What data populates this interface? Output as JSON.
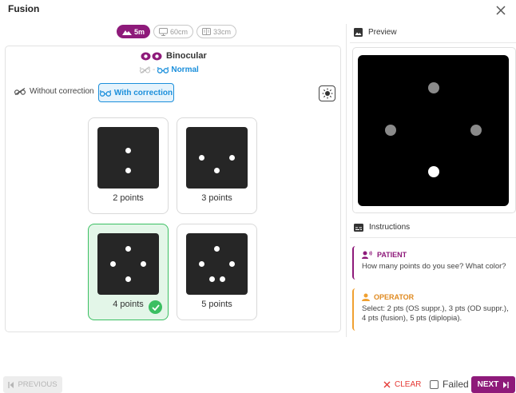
{
  "window": {
    "title": "Fusion"
  },
  "distances": [
    {
      "label": "5m",
      "icon": "mountain-icon",
      "active": true
    },
    {
      "label": "60cm",
      "icon": "monitor-icon",
      "active": false
    },
    {
      "label": "33cm",
      "icon": "book-icon",
      "active": false
    }
  ],
  "vision": {
    "mode": "Binocular",
    "separator": "-",
    "status": "Normal"
  },
  "correction": {
    "without_label": "Without correction",
    "with_label": "With correction",
    "selected": "with"
  },
  "options": [
    {
      "label": "2 points",
      "selected": false
    },
    {
      "label": "3 points",
      "selected": false
    },
    {
      "label": "4 points",
      "selected": true
    },
    {
      "label": "5 points",
      "selected": false
    }
  ],
  "preview": {
    "title": "Preview"
  },
  "instructions": {
    "title": "Instructions",
    "patient": {
      "title": "PATIENT",
      "text": "How many points do you see? What color?"
    },
    "operator": {
      "title": "OPERATOR",
      "text": "Select: 2 pts (OS suppr.), 3 pts (OD suppr.), 4 pts (fusion), 5 pts (diplopia)."
    }
  },
  "footer": {
    "previous_label": "PREVIOUS",
    "clear_label": "CLEAR",
    "failed_label": "Failed",
    "failed_checked": false,
    "next_label": "NEXT"
  },
  "colors": {
    "brand": "#8e1a7a",
    "accent_blue": "#1b8fdb",
    "success": "#3bbf62",
    "operator": "#f0a030",
    "danger": "#e53935"
  }
}
